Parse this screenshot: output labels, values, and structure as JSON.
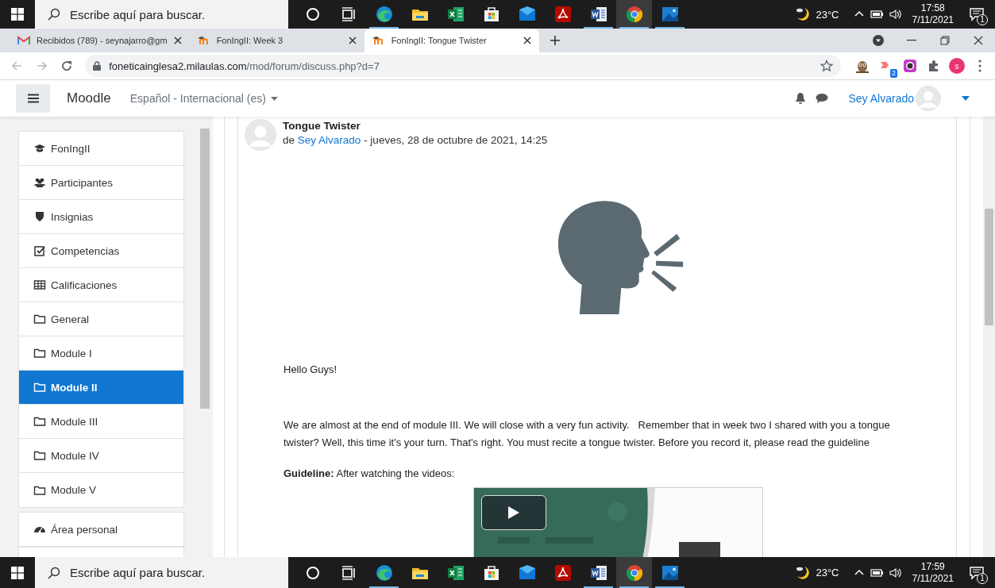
{
  "taskbar_top": {
    "search_placeholder": "Escribe aquí para buscar.",
    "apps": [
      {
        "kind": "cortana",
        "active": false,
        "open": false
      },
      {
        "kind": "taskview",
        "active": false,
        "open": false
      },
      {
        "kind": "edge",
        "active": false,
        "open": true
      },
      {
        "kind": "explorer",
        "active": false,
        "open": false
      },
      {
        "kind": "excel",
        "active": false,
        "open": false
      },
      {
        "kind": "store",
        "active": false,
        "open": false
      },
      {
        "kind": "mail",
        "active": false,
        "open": false
      },
      {
        "kind": "acrobat",
        "active": false,
        "open": false
      },
      {
        "kind": "word",
        "active": false,
        "open": true
      },
      {
        "kind": "chrome",
        "active": true,
        "open": true
      },
      {
        "kind": "photos",
        "active": false,
        "open": true
      }
    ],
    "temperature": "23°C",
    "time": "17:58",
    "date": "7/11/2021",
    "notifications": "1"
  },
  "browser": {
    "tabs": [
      {
        "kind": "gmail",
        "title": "Recibidos (789) - seynajarro@gm",
        "selected": false
      },
      {
        "kind": "moodle",
        "title": "FonIngII: Week 3",
        "selected": false
      },
      {
        "kind": "moodle",
        "title": "FonIngII: Tongue Twister",
        "selected": true
      }
    ],
    "url": {
      "host": "foneticainglesa2.milaulas.com",
      "path": "/mod/forum/discuss.php?d=7"
    },
    "extension_badge": "2",
    "profile_initial": "s"
  },
  "navbar": {
    "brand": "Moodle",
    "language": "Español - Internacional (es)",
    "user": "Sey Alvarado"
  },
  "sidebar": {
    "items": [
      {
        "kind": "course",
        "label": "FonIngII",
        "selected": false
      },
      {
        "kind": "participants",
        "label": "Participantes",
        "selected": false
      },
      {
        "kind": "badges",
        "label": "Insignias",
        "selected": false
      },
      {
        "kind": "competencies",
        "label": "Competencias",
        "selected": false
      },
      {
        "kind": "grades",
        "label": "Calificaciones",
        "selected": false
      },
      {
        "kind": "section",
        "label": "General",
        "selected": false
      },
      {
        "kind": "section",
        "label": "Module I",
        "selected": false
      },
      {
        "kind": "section",
        "label": "Module II",
        "selected": true
      },
      {
        "kind": "section",
        "label": "Module III",
        "selected": false
      },
      {
        "kind": "section",
        "label": "Module IV",
        "selected": false
      },
      {
        "kind": "section",
        "label": "Module V",
        "selected": false
      }
    ],
    "items_2": [
      {
        "kind": "dashboard",
        "label": "Área personal",
        "selected": false
      }
    ]
  },
  "post": {
    "title": "Tongue Twister",
    "by": "de",
    "author": "Sey Alvarado",
    "date": "- jueves, 28 de octubre de 2021, 14:25",
    "greeting": "Hello Guys!",
    "body": "We are almost at the end of module III. We will close with a very fun activity.   Remember that in week two I shared with you a tongue twister? Well, this time it's your turn. That's right. You must recite a tongue twister. Before you record it, please read the guideline",
    "guideline": "**Guideline:** After watching the videos:"
  },
  "taskbar_bottom": {
    "search_placeholder": "Escribe aquí para buscar.",
    "apps": [
      {
        "kind": "cortana",
        "active": false,
        "open": false
      },
      {
        "kind": "taskview",
        "active": false,
        "open": false
      },
      {
        "kind": "edge",
        "active": false,
        "open": true
      },
      {
        "kind": "explorer",
        "active": false,
        "open": false
      },
      {
        "kind": "excel",
        "active": false,
        "open": false
      },
      {
        "kind": "store",
        "active": false,
        "open": false
      },
      {
        "kind": "mail",
        "active": false,
        "open": false
      },
      {
        "kind": "acrobat",
        "active": false,
        "open": false
      },
      {
        "kind": "word",
        "active": false,
        "open": true
      },
      {
        "kind": "chrome",
        "active": true,
        "open": true
      },
      {
        "kind": "photos",
        "active": false,
        "open": true
      }
    ],
    "temperature": "23°C",
    "time": "17:59",
    "date": "7/11/2021",
    "notifications": "1"
  }
}
